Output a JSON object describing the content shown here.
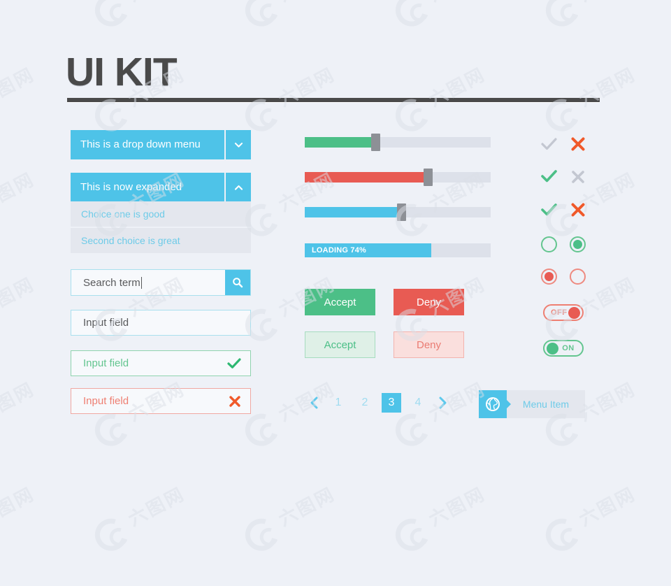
{
  "header": {
    "title": "UI KIT"
  },
  "colors": {
    "blue": "#4ec3e8",
    "green": "#4cbf87",
    "red": "#e85b53",
    "orange": "#f05a28",
    "gray": "#c3c7d1",
    "track": "#dde1ea",
    "background": "#eef1f7",
    "dark": "#4a4a4a"
  },
  "watermark": {
    "characters": "六图网"
  },
  "dropdown_collapsed": {
    "label": "This is a drop down menu",
    "toggle_icon": "chevron-down-icon"
  },
  "dropdown_expanded": {
    "label": "This is now expanded",
    "toggle_icon": "chevron-up-icon",
    "options": [
      "Choice one is good",
      "Second choice is great"
    ]
  },
  "search": {
    "value": "Search term",
    "placeholder": "Search term",
    "button_icon": "search-icon"
  },
  "inputs": [
    {
      "name": "plain",
      "value": "Input field",
      "placeholder": "Input field",
      "icon": null
    },
    {
      "name": "valid",
      "value": "Input field",
      "placeholder": "Input field",
      "icon": "check-icon"
    },
    {
      "name": "error",
      "value": "Input field",
      "placeholder": "Input field",
      "icon": "cross-icon"
    }
  ],
  "sliders": [
    {
      "name": "green-slider",
      "value": 38,
      "min": 0,
      "max": 100,
      "color": "#4cbf87"
    },
    {
      "name": "red-slider",
      "value": 66,
      "min": 0,
      "max": 100,
      "color": "#e85b53"
    },
    {
      "name": "blue-slider",
      "value": 52,
      "min": 0,
      "max": 100,
      "color": "#4ec3e8"
    }
  ],
  "progress": {
    "label": "LOADING 74%",
    "value": 68,
    "min": 0,
    "max": 100
  },
  "buttons": {
    "accept": "Accept",
    "deny": "Deny",
    "accept_light": "Accept",
    "deny_light": "Deny"
  },
  "pagination": {
    "prev_icon": "chevron-left-icon",
    "next_icon": "chevron-right-icon",
    "pages": [
      "1",
      "2",
      "3",
      "4"
    ],
    "active": "3"
  },
  "menu_item": {
    "label": "Menu Item",
    "icon": "globe-icon"
  },
  "indicators": {
    "row1": {
      "check": "check-icon",
      "check_state": "inactive",
      "cross": "cross-icon",
      "cross_state": "active"
    },
    "row2": {
      "check": "check-icon",
      "check_state": "active",
      "cross": "cross-icon",
      "cross_state": "inactive"
    },
    "row3": {
      "check": "check-icon",
      "check_state": "active",
      "cross": "cross-icon",
      "cross_state": "active"
    },
    "radios_green": [
      {
        "name": "radio-green-empty",
        "selected": false
      },
      {
        "name": "radio-green-filled",
        "selected": true
      }
    ],
    "radios_red": [
      {
        "name": "radio-red-filled",
        "selected": true
      },
      {
        "name": "radio-red-empty",
        "selected": false
      }
    ]
  },
  "toggles": {
    "off": {
      "label": "OFF",
      "state": "off"
    },
    "on": {
      "label": "ON",
      "state": "on"
    }
  }
}
